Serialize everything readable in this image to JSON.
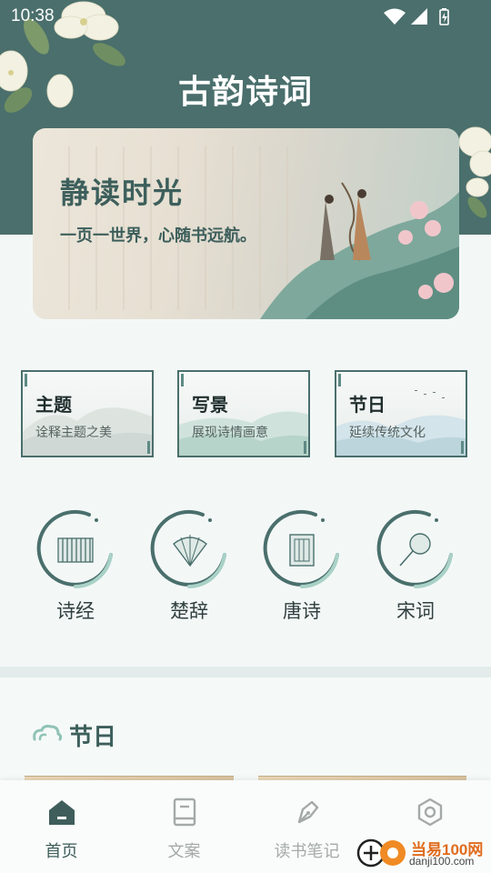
{
  "status_bar": {
    "time": "10:38"
  },
  "app": {
    "title": "古韵诗词"
  },
  "banner": {
    "title": "静读时光",
    "subtitle": "一页一世界，心随书远航。"
  },
  "categories": [
    {
      "title": "主题",
      "subtitle": "诠释主题之美"
    },
    {
      "title": "写景",
      "subtitle": "展现诗情画意"
    },
    {
      "title": "节日",
      "subtitle": "延续传统文化"
    }
  ],
  "collections": [
    {
      "label": "诗经",
      "icon": "bamboo-scroll-icon"
    },
    {
      "label": "楚辞",
      "icon": "folding-fan-icon"
    },
    {
      "label": "唐诗",
      "icon": "book-icon"
    },
    {
      "label": "宋词",
      "icon": "round-fan-icon"
    }
  ],
  "section": {
    "title": "节日"
  },
  "tabs": [
    {
      "label": "首页",
      "icon": "home-icon",
      "active": true
    },
    {
      "label": "文案",
      "icon": "book-icon",
      "active": false
    },
    {
      "label": "读书笔记",
      "icon": "pen-icon",
      "active": false
    },
    {
      "label": "",
      "icon": "hexagon-settings-icon",
      "active": false
    }
  ],
  "watermark": {
    "text": "当易100网",
    "url": "danji100.com"
  },
  "colors": {
    "primary": "#4a6f6c",
    "accent": "#8fc3b5",
    "background": "#f3f8f7",
    "watermark": "#e06b1e"
  }
}
